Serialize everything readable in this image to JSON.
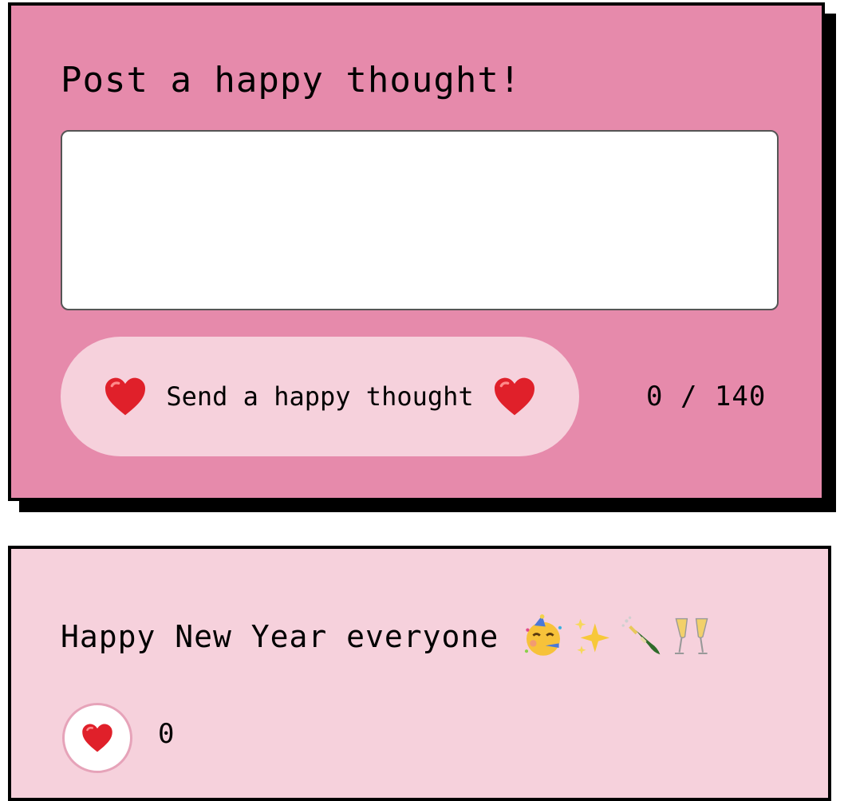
{
  "form": {
    "title": "Post a happy thought!",
    "input_value": "",
    "send_label": "Send a happy thought",
    "counter": "0 / 140",
    "heart_icon": "heart-icon",
    "bg_color": "#e68aab",
    "button_color": "#f6d1dc"
  },
  "messages": [
    {
      "text": "Happy New Year everyone",
      "emojis": [
        "partying-face-icon",
        "sparkles-icon",
        "champagne-bottle-icon",
        "clinking-glasses-icon"
      ],
      "likes": "0",
      "bg_color": "#f6d1dc"
    }
  ]
}
